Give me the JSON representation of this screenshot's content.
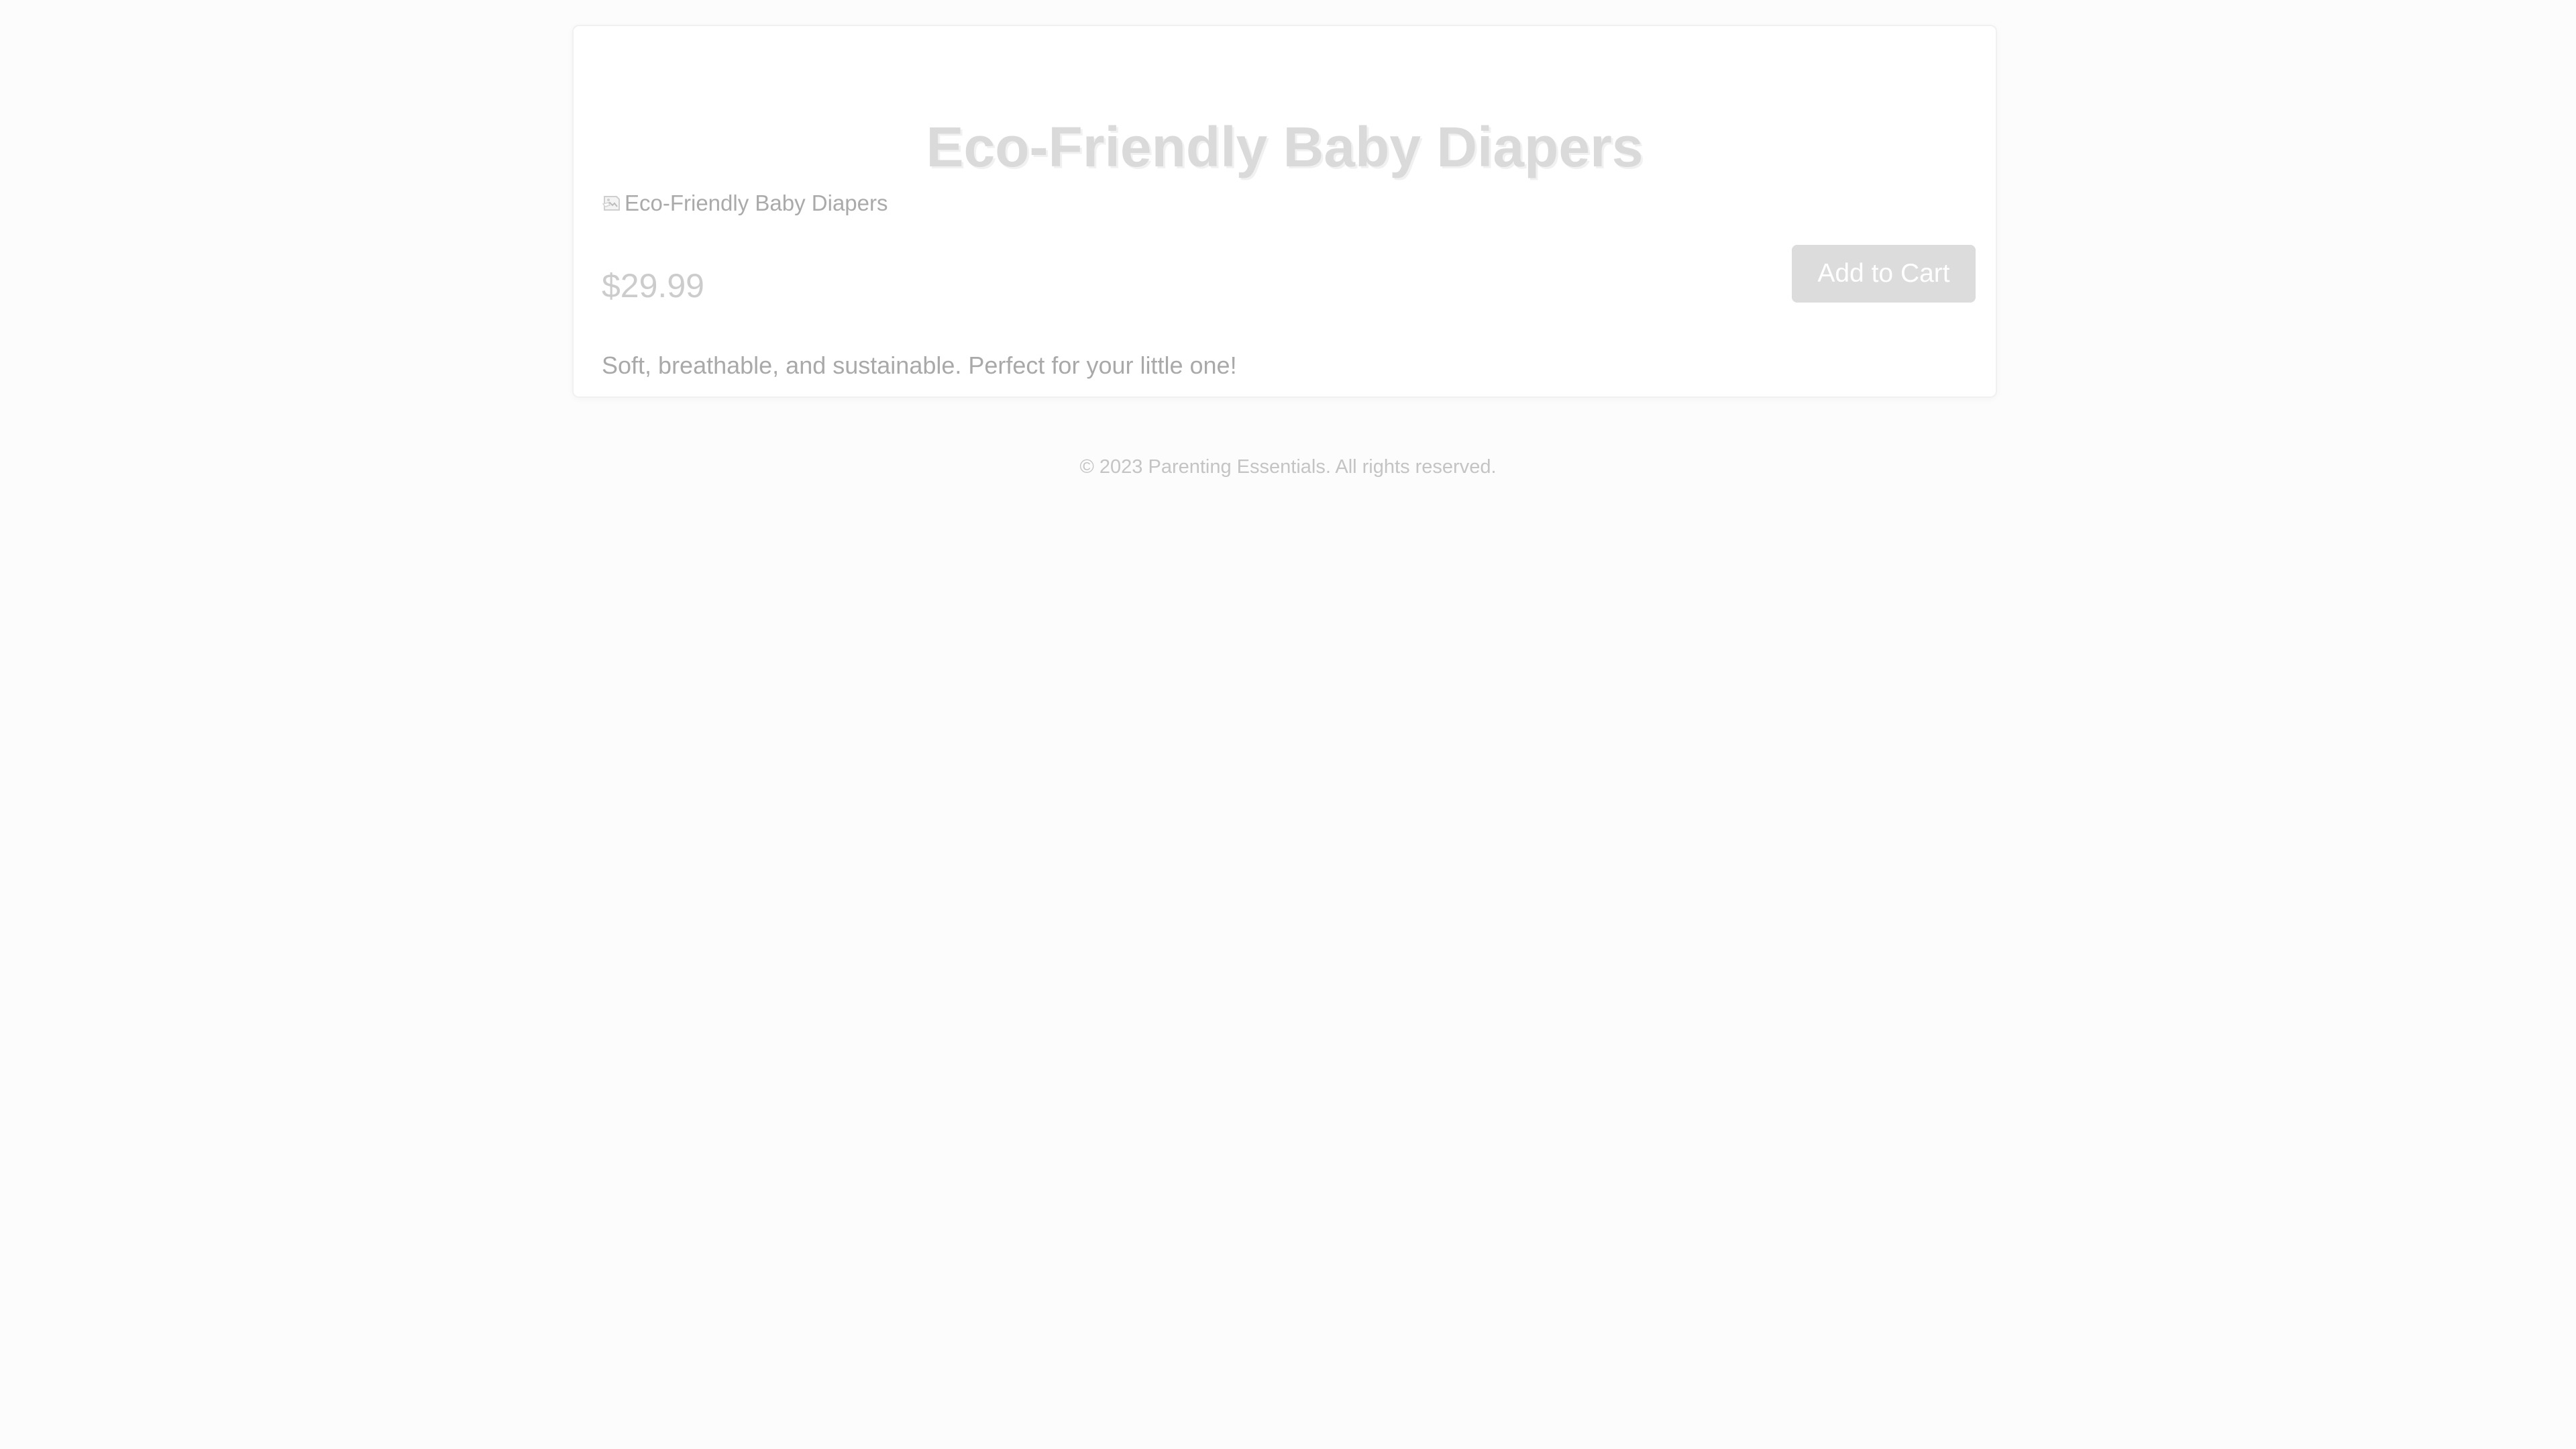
{
  "product": {
    "title": "Eco-Friendly Baby Diapers",
    "image": {
      "alt": "Eco-Friendly Baby Diapers",
      "icon": "broken-image-icon"
    },
    "price": "$29.99",
    "add_to_cart_label": "Add to Cart",
    "description": "Soft, breathable, and sustainable. Perfect for your little one!"
  },
  "footer": {
    "text": "© 2023 Parenting Essentials. All rights reserved."
  },
  "colors": {
    "background": "#fcfcfc",
    "card": "#ffffff",
    "button": "#dcdcdc",
    "title": "#dadada"
  }
}
